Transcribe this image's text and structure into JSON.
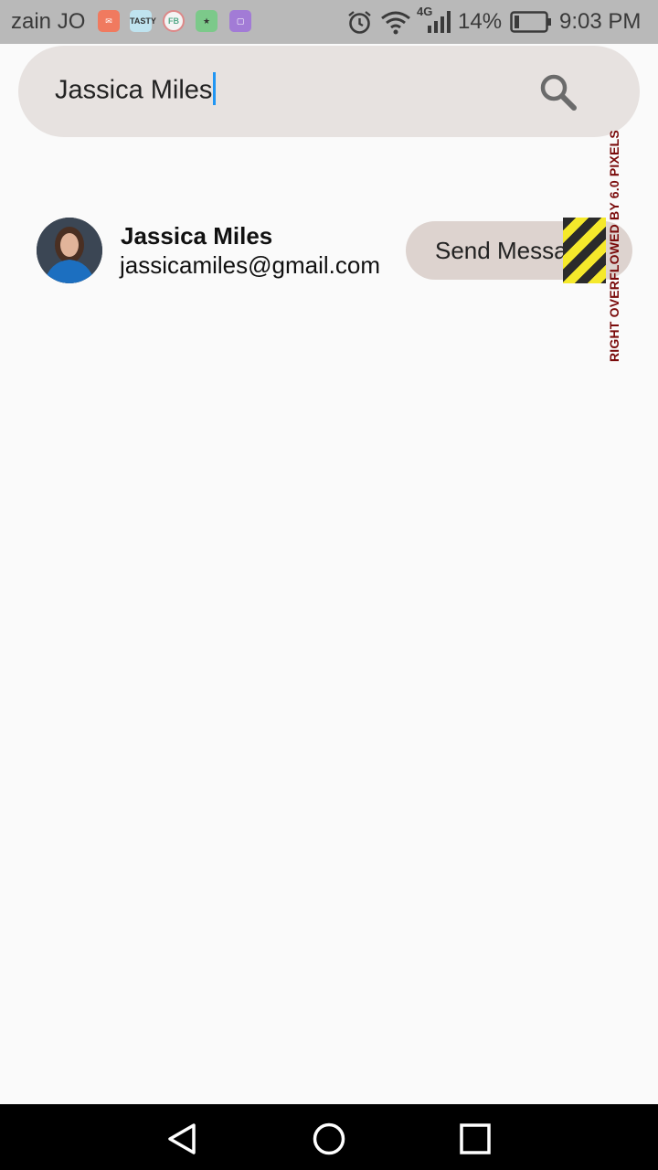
{
  "status_bar": {
    "carrier": "zain JO",
    "notification_icons": [
      "mail-app-icon",
      "tasty-app-icon",
      "fb-app-icon",
      "game-app-icon",
      "gallery-app-icon"
    ],
    "notification_labels": [
      "",
      "TASTY",
      "FB",
      "",
      ""
    ],
    "network": "4G",
    "battery_percent": "14%",
    "time": "9:03 PM"
  },
  "search": {
    "query": "Jassica Miles",
    "icon": "search-icon"
  },
  "results": [
    {
      "name": "Jassica Miles",
      "email": "jassicamiles@gmail.com",
      "action_label": "Send Message"
    }
  ],
  "debug_overlay": {
    "message": "RIGHT OVERFLOWED BY 6.0 PIXELS"
  },
  "nav_bar": {
    "icons": [
      "back-icon",
      "home-icon",
      "recents-icon"
    ]
  },
  "colors": {
    "status_bar_bg": "#b9b9b9",
    "search_bg": "#e7e2e0",
    "button_bg": "#ddd3cf",
    "caret": "#2196f3",
    "overflow_text": "#7a0b0b",
    "page_bg": "#fafafa"
  }
}
